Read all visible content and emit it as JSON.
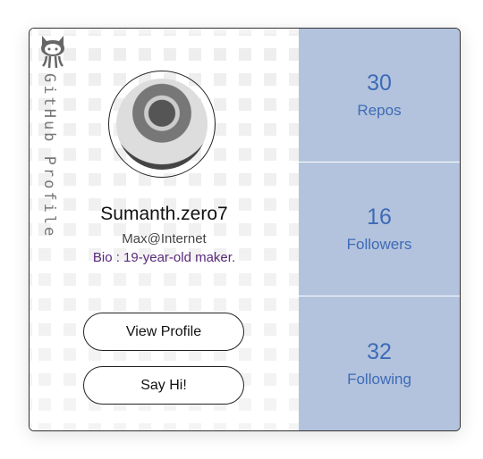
{
  "sidebar": {
    "label": "GitHub Profile",
    "logo_icon": "github-octocat-icon"
  },
  "profile": {
    "name": "Sumanth.zero7",
    "handle": "Max@Internet",
    "bio": "Bio : 19-year-old maker."
  },
  "buttons": {
    "view_profile": "View Profile",
    "say_hi": "Say Hi!"
  },
  "stats": [
    {
      "value": "30",
      "label": "Repos"
    },
    {
      "value": "16",
      "label": "Followers"
    },
    {
      "value": "32",
      "label": "Following"
    }
  ],
  "colors": {
    "stats_bg": "#b3c3dd",
    "stats_text": "#3e6bb6"
  }
}
